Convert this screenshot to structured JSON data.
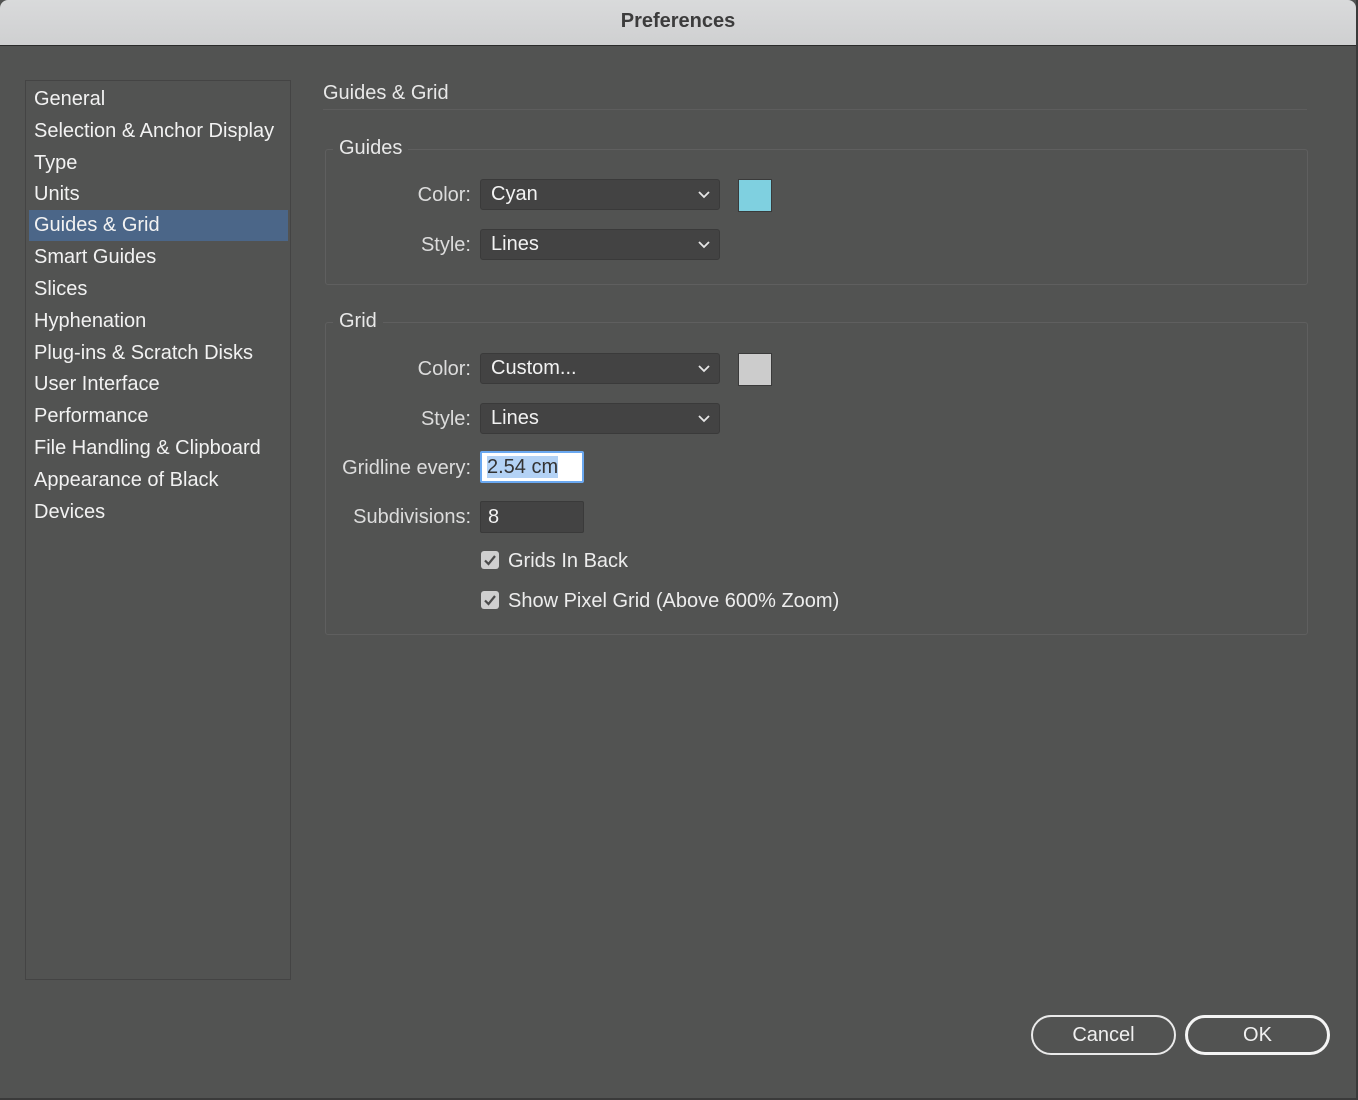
{
  "window": {
    "title": "Preferences"
  },
  "sidebar": {
    "items": [
      {
        "label": "General"
      },
      {
        "label": "Selection & Anchor Display"
      },
      {
        "label": "Type"
      },
      {
        "label": "Units"
      },
      {
        "label": "Guides & Grid",
        "selected": true
      },
      {
        "label": "Smart Guides"
      },
      {
        "label": "Slices"
      },
      {
        "label": "Hyphenation"
      },
      {
        "label": "Plug-ins & Scratch Disks"
      },
      {
        "label": "User Interface"
      },
      {
        "label": "Performance"
      },
      {
        "label": "File Handling & Clipboard"
      },
      {
        "label": "Appearance of Black"
      },
      {
        "label": "Devices"
      }
    ]
  },
  "panel": {
    "title": "Guides & Grid"
  },
  "guides": {
    "group_label": "Guides",
    "color_label": "Color:",
    "color_value": "Cyan",
    "color_swatch": "#7fd0e0",
    "style_label": "Style:",
    "style_value": "Lines"
  },
  "grid": {
    "group_label": "Grid",
    "color_label": "Color:",
    "color_value": "Custom...",
    "color_swatch": "#cccccc",
    "style_label": "Style:",
    "style_value": "Lines",
    "gridline_label": "Gridline every:",
    "gridline_value": "2.54 cm",
    "subdivisions_label": "Subdivisions:",
    "subdivisions_value": "8",
    "grids_in_back_label": "Grids In Back",
    "grids_in_back_checked": true,
    "pixel_grid_label": "Show Pixel Grid (Above 600% Zoom)",
    "pixel_grid_checked": true
  },
  "buttons": {
    "cancel": "Cancel",
    "ok": "OK"
  },
  "icons": {
    "dropdown": "chevron-down-icon",
    "check": "checkmark-icon"
  }
}
